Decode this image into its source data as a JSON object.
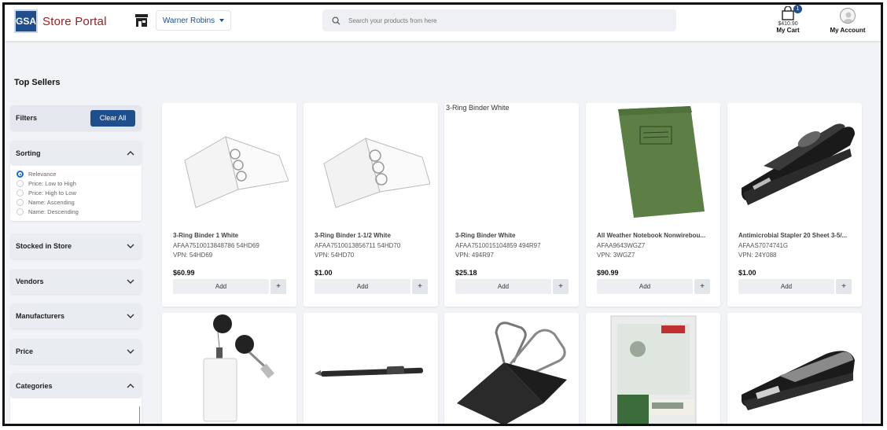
{
  "header": {
    "logo_text": "GSA",
    "title": "Store Portal",
    "location": "Warner Robins",
    "search_placeholder": "Search your products from here",
    "cart_count": "1",
    "cart_total": "$410.90",
    "cart_label": "My Cart",
    "account_label": "My Account"
  },
  "page": {
    "title": "Top Sellers"
  },
  "filters": {
    "title": "Filters",
    "clear_label": "Clear All",
    "sorting": {
      "title": "Sorting",
      "options": [
        "Relevance",
        "Price: Low to High",
        "Price: High to Low",
        "Name: Ascending",
        "Name: Descending"
      ],
      "selected": "Relevance"
    },
    "sections": [
      "Stocked in Store",
      "Vendors",
      "Manufacturers",
      "Price",
      "Categories"
    ]
  },
  "products": [
    {
      "name": "3-Ring Binder 1 White",
      "sku": "AFAA7510013848786 54HD69",
      "vpn": "VPN: 54HD69",
      "price": "$60.99",
      "add_label": "Add",
      "image": "binder-icon"
    },
    {
      "name": "3-Ring Binder 1-1/2 White",
      "sku": "AFAA7510013856711 54HD70",
      "vpn": "VPN: 54HD70",
      "price": "$1.00",
      "add_label": "Add",
      "image": "binder-icon"
    },
    {
      "name": "3-Ring Binder White",
      "sku": "AFAA7510015104859 494R97",
      "vpn": "VPN: 494R97",
      "price": "$25.18",
      "add_label": "Add",
      "image": "broken-image",
      "alt": "3-Ring Binder White"
    },
    {
      "name": "All Weather Notebook Nonwirebou...",
      "sku": "AFAA9643WGZ7",
      "vpn": "VPN: 3WGZ7",
      "price": "$90.99",
      "add_label": "Add",
      "image": "notebook-icon"
    },
    {
      "name": "Antimicrobial Stapler 20 Sheet 3-5/...",
      "sku": "AFAAS7074741G",
      "vpn": "VPN: 24Y088",
      "price": "$1.00",
      "add_label": "Add",
      "image": "stapler-icon"
    },
    {
      "image": "badge-reel-icon"
    },
    {
      "image": "pen-icon"
    },
    {
      "image": "binder-clip-icon"
    },
    {
      "image": "index-dividers-icon"
    },
    {
      "image": "stapler-icon"
    }
  ],
  "colors": {
    "brand_blue": "#1f4e8c",
    "brand_red": "#9b1c1c",
    "background": "#f1f3f6"
  }
}
